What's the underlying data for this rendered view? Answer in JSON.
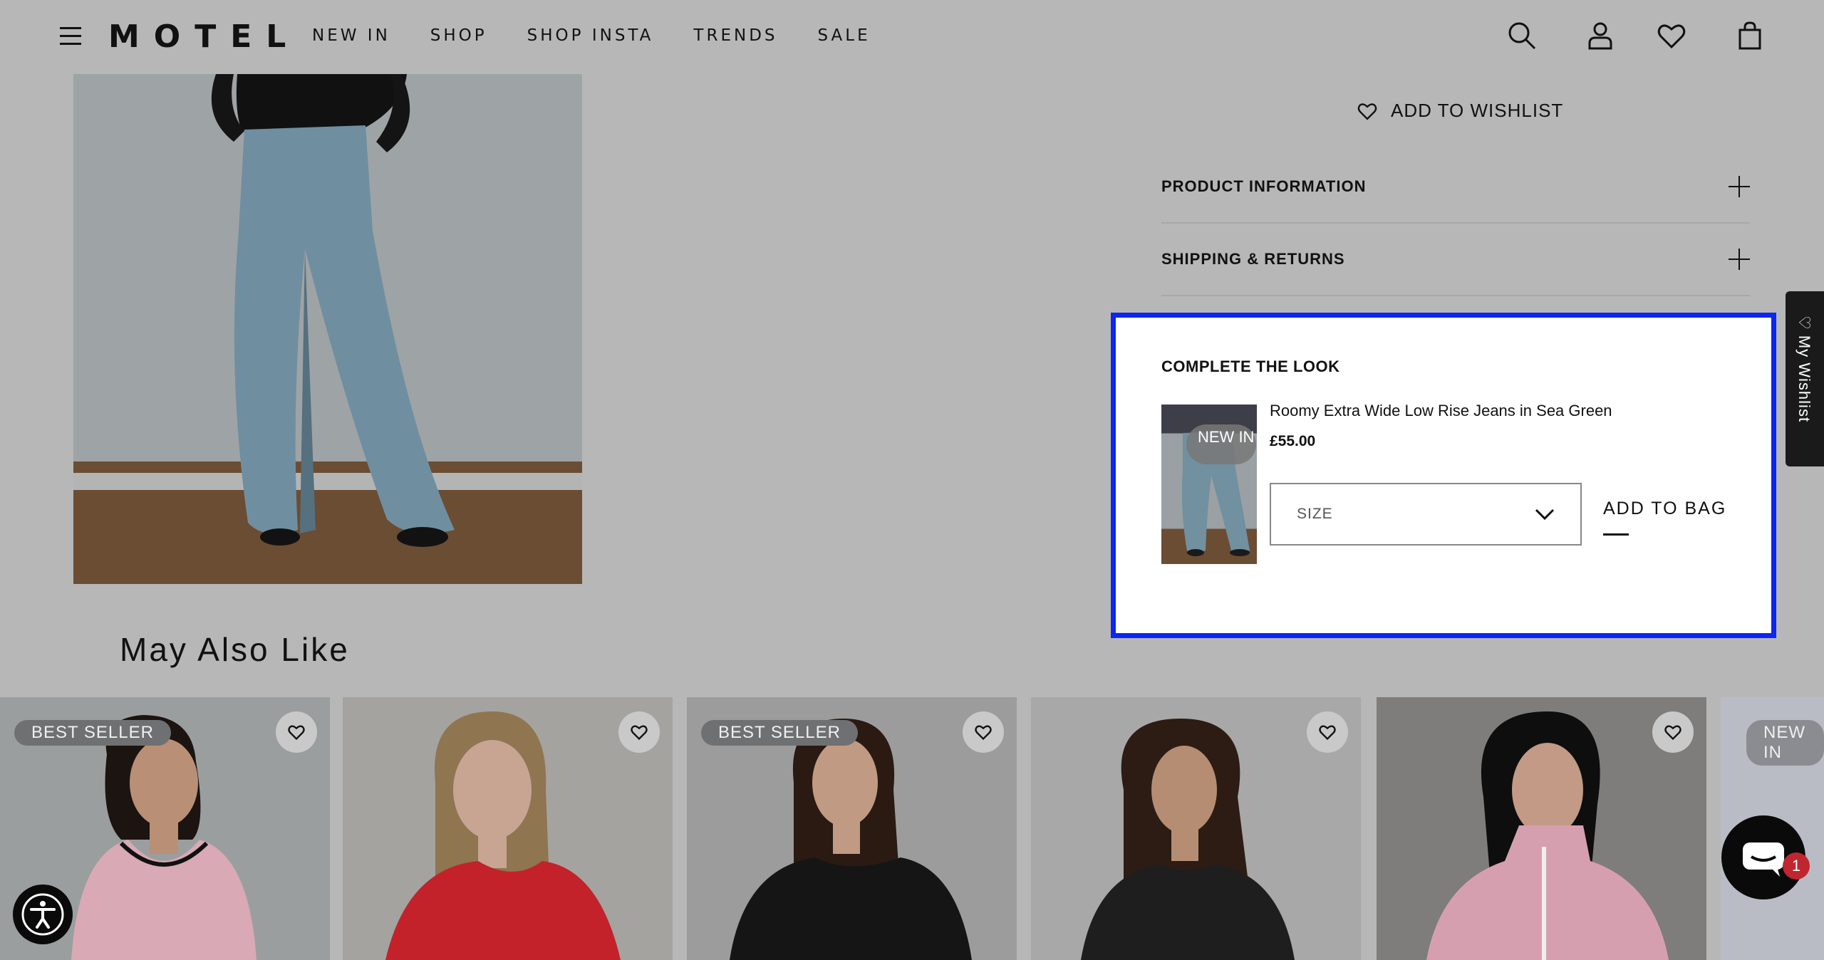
{
  "header": {
    "logo": "MOTEL",
    "nav": [
      "NEW IN",
      "SHOP",
      "SHOP INSTA",
      "TRENDS",
      "SALE"
    ],
    "icons": [
      "menu-icon",
      "search-icon",
      "account-icon",
      "wishlist-heart-icon",
      "bag-icon"
    ]
  },
  "product": {
    "wishlist_label": "ADD TO WISHLIST",
    "accordions": [
      "PRODUCT INFORMATION",
      "SHIPPING & RETURNS"
    ]
  },
  "complete_the_look": {
    "title": "COMPLETE THE LOOK",
    "item": {
      "name": "Roomy Extra Wide Low Rise Jeans in Sea Green",
      "price": "£55.00",
      "badge": "NEW IN",
      "size_placeholder": "SIZE",
      "add_label": "ADD TO BAG"
    }
  },
  "side_tab": {
    "label": "My Wishlist"
  },
  "recommendations": {
    "title": "May Also Like",
    "cards": [
      {
        "badge": "BEST SELLER",
        "color": "#d9a9b5"
      },
      {
        "badge": "",
        "color": "#c3222b"
      },
      {
        "badge": "BEST SELLER",
        "color": "#151515"
      },
      {
        "badge": "",
        "color": "#1e1e1e"
      },
      {
        "badge": "",
        "color": "#d69fb0"
      },
      {
        "badge": "NEW IN",
        "color": "#b9bcc4"
      }
    ]
  },
  "chat": {
    "count": "1"
  },
  "colors": {
    "highlight": "#0c25f0",
    "overlay": "#b7b7b7"
  }
}
